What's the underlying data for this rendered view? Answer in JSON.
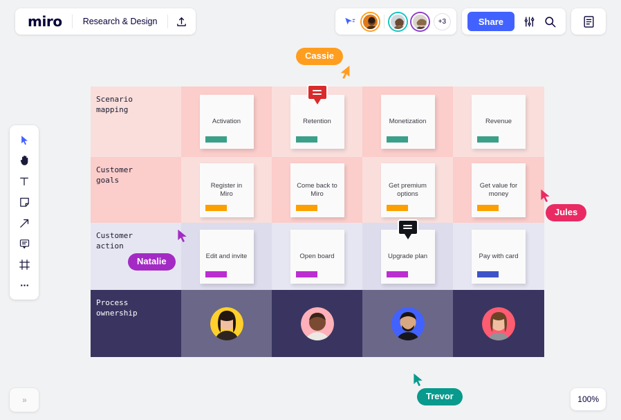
{
  "app": {
    "logo": "miro",
    "board_name": "Research & Design",
    "zoom_level": "100%"
  },
  "topbar_left": {
    "upload_icon": "upload-icon"
  },
  "topbar_right": {
    "cursor_share_icon": "cursor-share-icon",
    "collaborators": [
      {
        "name": "collaborator-1",
        "ring": "#ff9d1e"
      },
      {
        "name": "collaborator-2",
        "ring": "#0fc6c2"
      },
      {
        "name": "collaborator-3",
        "ring": "#8c3bcd"
      }
    ],
    "more_count": "+3",
    "share_label": "Share",
    "filters_icon": "sliders-icon",
    "search_icon": "search-icon",
    "notes_icon": "document-icon"
  },
  "left_toolbar": {
    "tools": [
      {
        "name": "select-tool",
        "icon": "cursor-icon"
      },
      {
        "name": "hand-tool",
        "icon": "hand-icon"
      },
      {
        "name": "text-tool",
        "icon": "text-icon"
      },
      {
        "name": "sticky-tool",
        "icon": "sticky-note-icon"
      },
      {
        "name": "arrow-tool",
        "icon": "arrow-icon"
      },
      {
        "name": "comment-tool",
        "icon": "comment-icon"
      },
      {
        "name": "frame-tool",
        "icon": "frame-icon"
      },
      {
        "name": "more-tool",
        "icon": "more-dots-icon"
      }
    ]
  },
  "board": {
    "rows": [
      {
        "label": "Scenario\nmapping",
        "label_color": "dark",
        "tint_a": "#f9dedc",
        "tint_b": "#fbcdcb",
        "cards": [
          {
            "text": "Activation",
            "bar": "green",
            "comment": null
          },
          {
            "text": "Retention",
            "bar": "green",
            "comment": "red"
          },
          {
            "text": "Monetization",
            "bar": "green",
            "comment": null
          },
          {
            "text": "Revenue",
            "bar": "green",
            "comment": null
          }
        ]
      },
      {
        "label": "Customer\ngoals",
        "label_color": "dark",
        "tint_a": "#fbcdcb",
        "tint_b": "#f9dedc",
        "cards": [
          {
            "text": "Register in Miro",
            "bar": "orange",
            "comment": null
          },
          {
            "text": "Come back to Miro",
            "bar": "orange",
            "comment": null
          },
          {
            "text": "Get premium options",
            "bar": "orange",
            "comment": null
          },
          {
            "text": "Get value for money",
            "bar": "orange",
            "comment": null
          }
        ]
      },
      {
        "label": "Customer\naction",
        "label_color": "dark",
        "tint_a": "#e6e6f2",
        "tint_b": "#dcdcec",
        "cards": [
          {
            "text": "Edit and invite",
            "bar": "purple",
            "comment": null
          },
          {
            "text": "Open board",
            "bar": "purple",
            "comment": null
          },
          {
            "text": "Upgrade plan",
            "bar": "purple",
            "comment": "black"
          },
          {
            "text": "Pay with card",
            "bar": "blue",
            "comment": null
          }
        ]
      },
      {
        "label": "Process\nownership",
        "label_color": "light",
        "tint_a": "#393560",
        "tint_b": "#6b6789",
        "owners": [
          {
            "name": "owner-avatar-1",
            "bg": "#ffd02b",
            "skin": "#f2c0a0",
            "hair": "#3a2418"
          },
          {
            "name": "owner-avatar-2",
            "bg": "#ffb0b8",
            "skin": "#7a4a32",
            "hair": "#241812"
          },
          {
            "name": "owner-avatar-3",
            "bg": "#4262ff",
            "skin": "#d8a882",
            "hair": "#1d1410"
          },
          {
            "name": "owner-avatar-4",
            "bg": "#ff5c72",
            "skin": "#f0bfa2",
            "hair": "#5a3a24"
          }
        ]
      }
    ]
  },
  "collaborators_cursors": [
    {
      "name": "Cassie",
      "color": "#ff9d1e"
    },
    {
      "name": "Jules",
      "color": "#ea2a63"
    },
    {
      "name": "Natalie",
      "color": "#a32bc4"
    },
    {
      "name": "Trevor",
      "color": "#089a8c"
    }
  ],
  "bottom": {
    "expand_icon": "chevron-double-right-icon",
    "zoom_level": "100%"
  }
}
